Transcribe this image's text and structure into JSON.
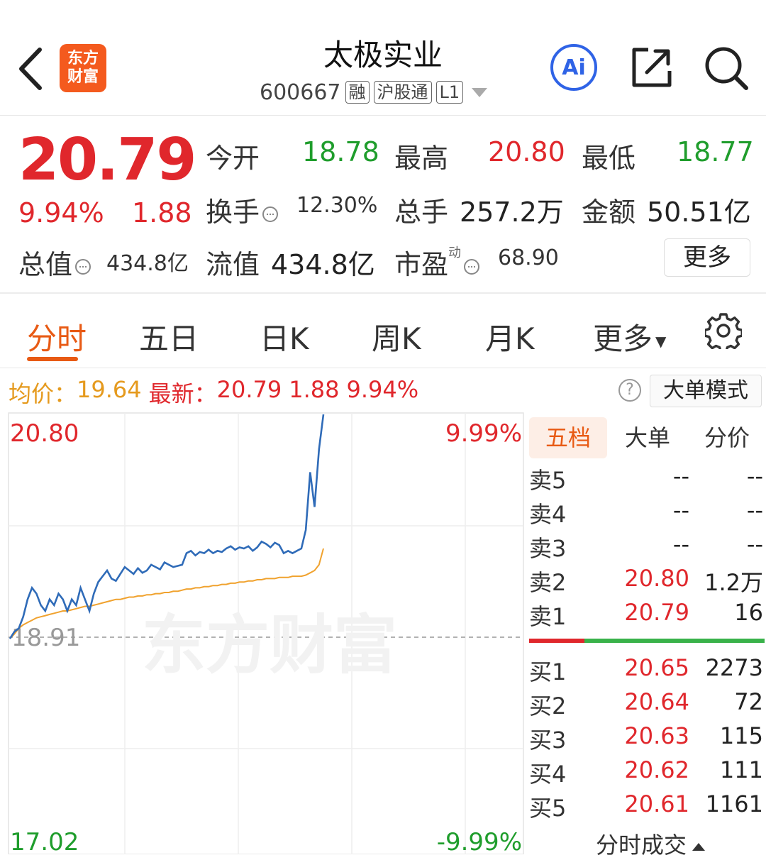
{
  "header": {
    "logo_line1": "东方",
    "logo_line2": "财富",
    "title": "太极实业",
    "code": "600667",
    "tags": [
      "融",
      "沪股通",
      "L1"
    ],
    "ai_label": "Ai"
  },
  "quote": {
    "price": "20.79",
    "change_pct": "9.94%",
    "change": "1.88",
    "open_label": "今开",
    "open": "18.78",
    "high_label": "最高",
    "high": "20.80",
    "low_label": "最低",
    "low": "18.77",
    "turnover_label": "换手",
    "turnover": "12.30%",
    "volume_label": "总手",
    "volume": "257.2万",
    "amount_label": "金额",
    "amount": "50.51亿",
    "mktcap_label": "总值",
    "mktcap": "434.8亿",
    "float_label": "流值",
    "float_cap": "434.8亿",
    "pe_label": "市盈",
    "pe_sup": "动",
    "pe": "68.90",
    "more_label": "更多"
  },
  "tabs": [
    "分时",
    "五日",
    "日K",
    "周K",
    "月K",
    "更多"
  ],
  "info_bar": {
    "avg_label": "均价：",
    "avg": "19.64",
    "latest_label": "最新：",
    "latest": "20.79",
    "change": "1.88",
    "change_pct": "9.94%",
    "help": "?",
    "big_order_mode": "大单模式"
  },
  "chart_axes": {
    "top_price": "20.80",
    "top_pct": "9.99%",
    "base_price": "18.91",
    "bottom_price": "17.02",
    "bottom_pct": "-9.99%",
    "watermark": "东方财富"
  },
  "chart_data": {
    "type": "line",
    "ylim": [
      17.02,
      20.8
    ],
    "prev_close": 18.91,
    "series": [
      {
        "values": [
          18.86,
          18.92,
          18.95,
          19.05,
          19.2,
          19.3,
          19.25,
          19.15,
          19.1,
          19.2,
          19.15,
          19.25,
          19.2,
          19.1,
          19.2,
          19.15,
          19.3,
          19.2,
          19.1,
          19.25,
          19.35,
          19.4,
          19.45,
          19.38,
          19.36,
          19.42,
          19.48,
          19.45,
          19.42,
          19.47,
          19.43,
          19.45,
          19.5,
          19.48,
          19.46,
          19.52,
          19.5,
          19.48,
          19.49,
          19.5,
          19.6,
          19.62,
          19.58,
          19.61,
          19.6,
          19.63,
          19.6,
          19.62,
          19.61,
          19.64,
          19.66,
          19.63,
          19.65,
          19.64,
          19.66,
          19.62,
          19.65,
          19.7,
          19.68,
          19.65,
          19.69,
          19.67,
          19.6,
          19.62,
          19.6,
          19.62,
          19.64,
          19.8,
          20.3,
          20.0,
          20.5,
          20.8
        ],
        "color": "#2f6bb8"
      },
      {
        "values": [
          18.86,
          18.9,
          18.95,
          18.98,
          19.0,
          19.02,
          19.04,
          19.05,
          19.06,
          19.07,
          19.08,
          19.09,
          19.1,
          19.1,
          19.11,
          19.12,
          19.13,
          19.14,
          19.14,
          19.15,
          19.16,
          19.17,
          19.18,
          19.19,
          19.2,
          19.2,
          19.21,
          19.22,
          19.22,
          19.23,
          19.23,
          19.24,
          19.24,
          19.25,
          19.25,
          19.26,
          19.26,
          19.27,
          19.27,
          19.28,
          19.29,
          19.29,
          19.3,
          19.3,
          19.31,
          19.31,
          19.32,
          19.32,
          19.33,
          19.33,
          19.34,
          19.34,
          19.35,
          19.35,
          19.36,
          19.36,
          19.37,
          19.37,
          19.38,
          19.38,
          19.38,
          19.39,
          19.39,
          19.39,
          19.4,
          19.4,
          19.4,
          19.41,
          19.43,
          19.45,
          19.5,
          19.64
        ],
        "color": "#f0a22e"
      }
    ]
  },
  "order_book": {
    "tabs": [
      "五档",
      "大单",
      "分价"
    ],
    "asks": [
      {
        "label": "卖5",
        "price": "--",
        "volume": "--"
      },
      {
        "label": "卖4",
        "price": "--",
        "volume": "--"
      },
      {
        "label": "卖3",
        "price": "--",
        "volume": "--"
      },
      {
        "label": "卖2",
        "price": "20.80",
        "volume": "1.2万"
      },
      {
        "label": "卖1",
        "price": "20.79",
        "volume": "16"
      }
    ],
    "bids": [
      {
        "label": "买1",
        "price": "20.65",
        "volume": "2273"
      },
      {
        "label": "买2",
        "price": "20.64",
        "volume": "72"
      },
      {
        "label": "买3",
        "price": "20.63",
        "volume": "115"
      },
      {
        "label": "买4",
        "price": "20.62",
        "volume": "111"
      },
      {
        "label": "买5",
        "price": "20.61",
        "volume": "1161"
      }
    ],
    "ticks_label": "分时成交"
  }
}
